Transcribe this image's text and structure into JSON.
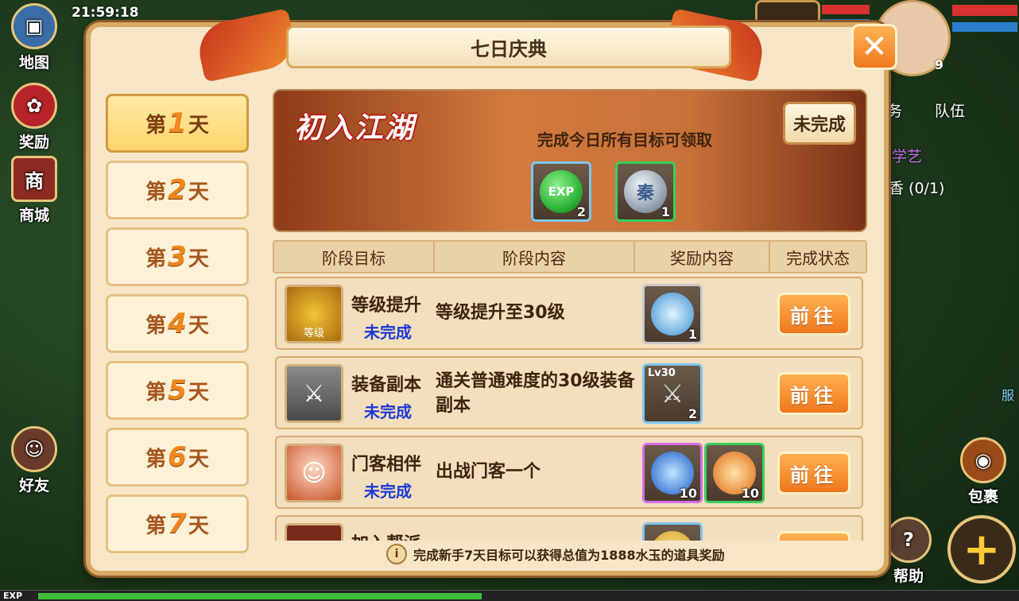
{
  "hud": {
    "time": "21:59:18",
    "left_buttons": [
      {
        "label": "地图",
        "icon": "map-icon"
      },
      {
        "label": "奖励",
        "icon": "gift-bag-icon"
      },
      {
        "label": "商城",
        "icon": "shop-icon"
      },
      {
        "label": "好友",
        "icon": "friend-icon"
      }
    ],
    "right_text": {
      "tab_partial": "务",
      "team_tab": "队伍",
      "skill_text": "学艺",
      "quest_text": "香 (0/1)",
      "side_text": "服"
    },
    "right_buttons": [
      {
        "label": "包裹"
      },
      {
        "label": "帮助"
      }
    ],
    "avatar_level": "9",
    "exp_label": "EXP",
    "exp_fraction": 0.46
  },
  "dialog": {
    "title": "七日庆典",
    "close_icon": "close-icon",
    "days": [
      {
        "prefix": "第",
        "num": "1",
        "suffix": "天",
        "active": true
      },
      {
        "prefix": "第",
        "num": "2",
        "suffix": "天"
      },
      {
        "prefix": "第",
        "num": "3",
        "suffix": "天"
      },
      {
        "prefix": "第",
        "num": "4",
        "suffix": "天"
      },
      {
        "prefix": "第",
        "num": "5",
        "suffix": "天"
      },
      {
        "prefix": "第",
        "num": "6",
        "suffix": "天"
      },
      {
        "prefix": "第",
        "num": "7",
        "suffix": "天"
      }
    ],
    "banner": {
      "title": "初入江湖",
      "desc": "完成今日所有目标可领取",
      "status": "未完成",
      "rewards": [
        {
          "icon": "exp-orb-icon",
          "text": "EXP",
          "count": "2",
          "color": "#2fb63a"
        },
        {
          "icon": "qin-coin-icon",
          "text": "秦",
          "count": "1",
          "color": "#9aa6b5"
        }
      ]
    },
    "table": {
      "headers": [
        "阶段目标",
        "阶段内容",
        "奖励内容",
        "完成状态"
      ],
      "rows": [
        {
          "name": "等级提升",
          "status": "未完成",
          "icon": "level-up-icon",
          "icon_text": "等级",
          "content": "等级提升至30级",
          "rewards": [
            {
              "icon": "jade-ring-icon",
              "count": "1"
            }
          ],
          "button": "前往"
        },
        {
          "name": "装备副本",
          "status": "未完成",
          "icon": "equipment-icon",
          "icon_text": "",
          "content": "通关普通难度的30级装备副本",
          "rewards": [
            {
              "icon": "equipment-icon",
              "count": "2",
              "tag": "Lv30"
            }
          ],
          "button": "前往"
        },
        {
          "name": "门客相伴",
          "status": "未完成",
          "icon": "retainer-avatar-icon",
          "icon_text": "",
          "content": "出战门客一个",
          "rewards": [
            {
              "icon": "blue-gourd-icon",
              "count": "10"
            },
            {
              "icon": "orange-orb-icon",
              "count": "10"
            }
          ],
          "button": "前往"
        },
        {
          "name": "加入帮派",
          "status": "",
          "icon": "guild-icon",
          "icon_text": "",
          "content": "",
          "rewards": [
            {
              "icon": "gold-item-icon",
              "count": ""
            }
          ],
          "button": ""
        }
      ]
    },
    "footer": "完成新手7天目标可以获得总值为1888水玉的道具奖励"
  }
}
